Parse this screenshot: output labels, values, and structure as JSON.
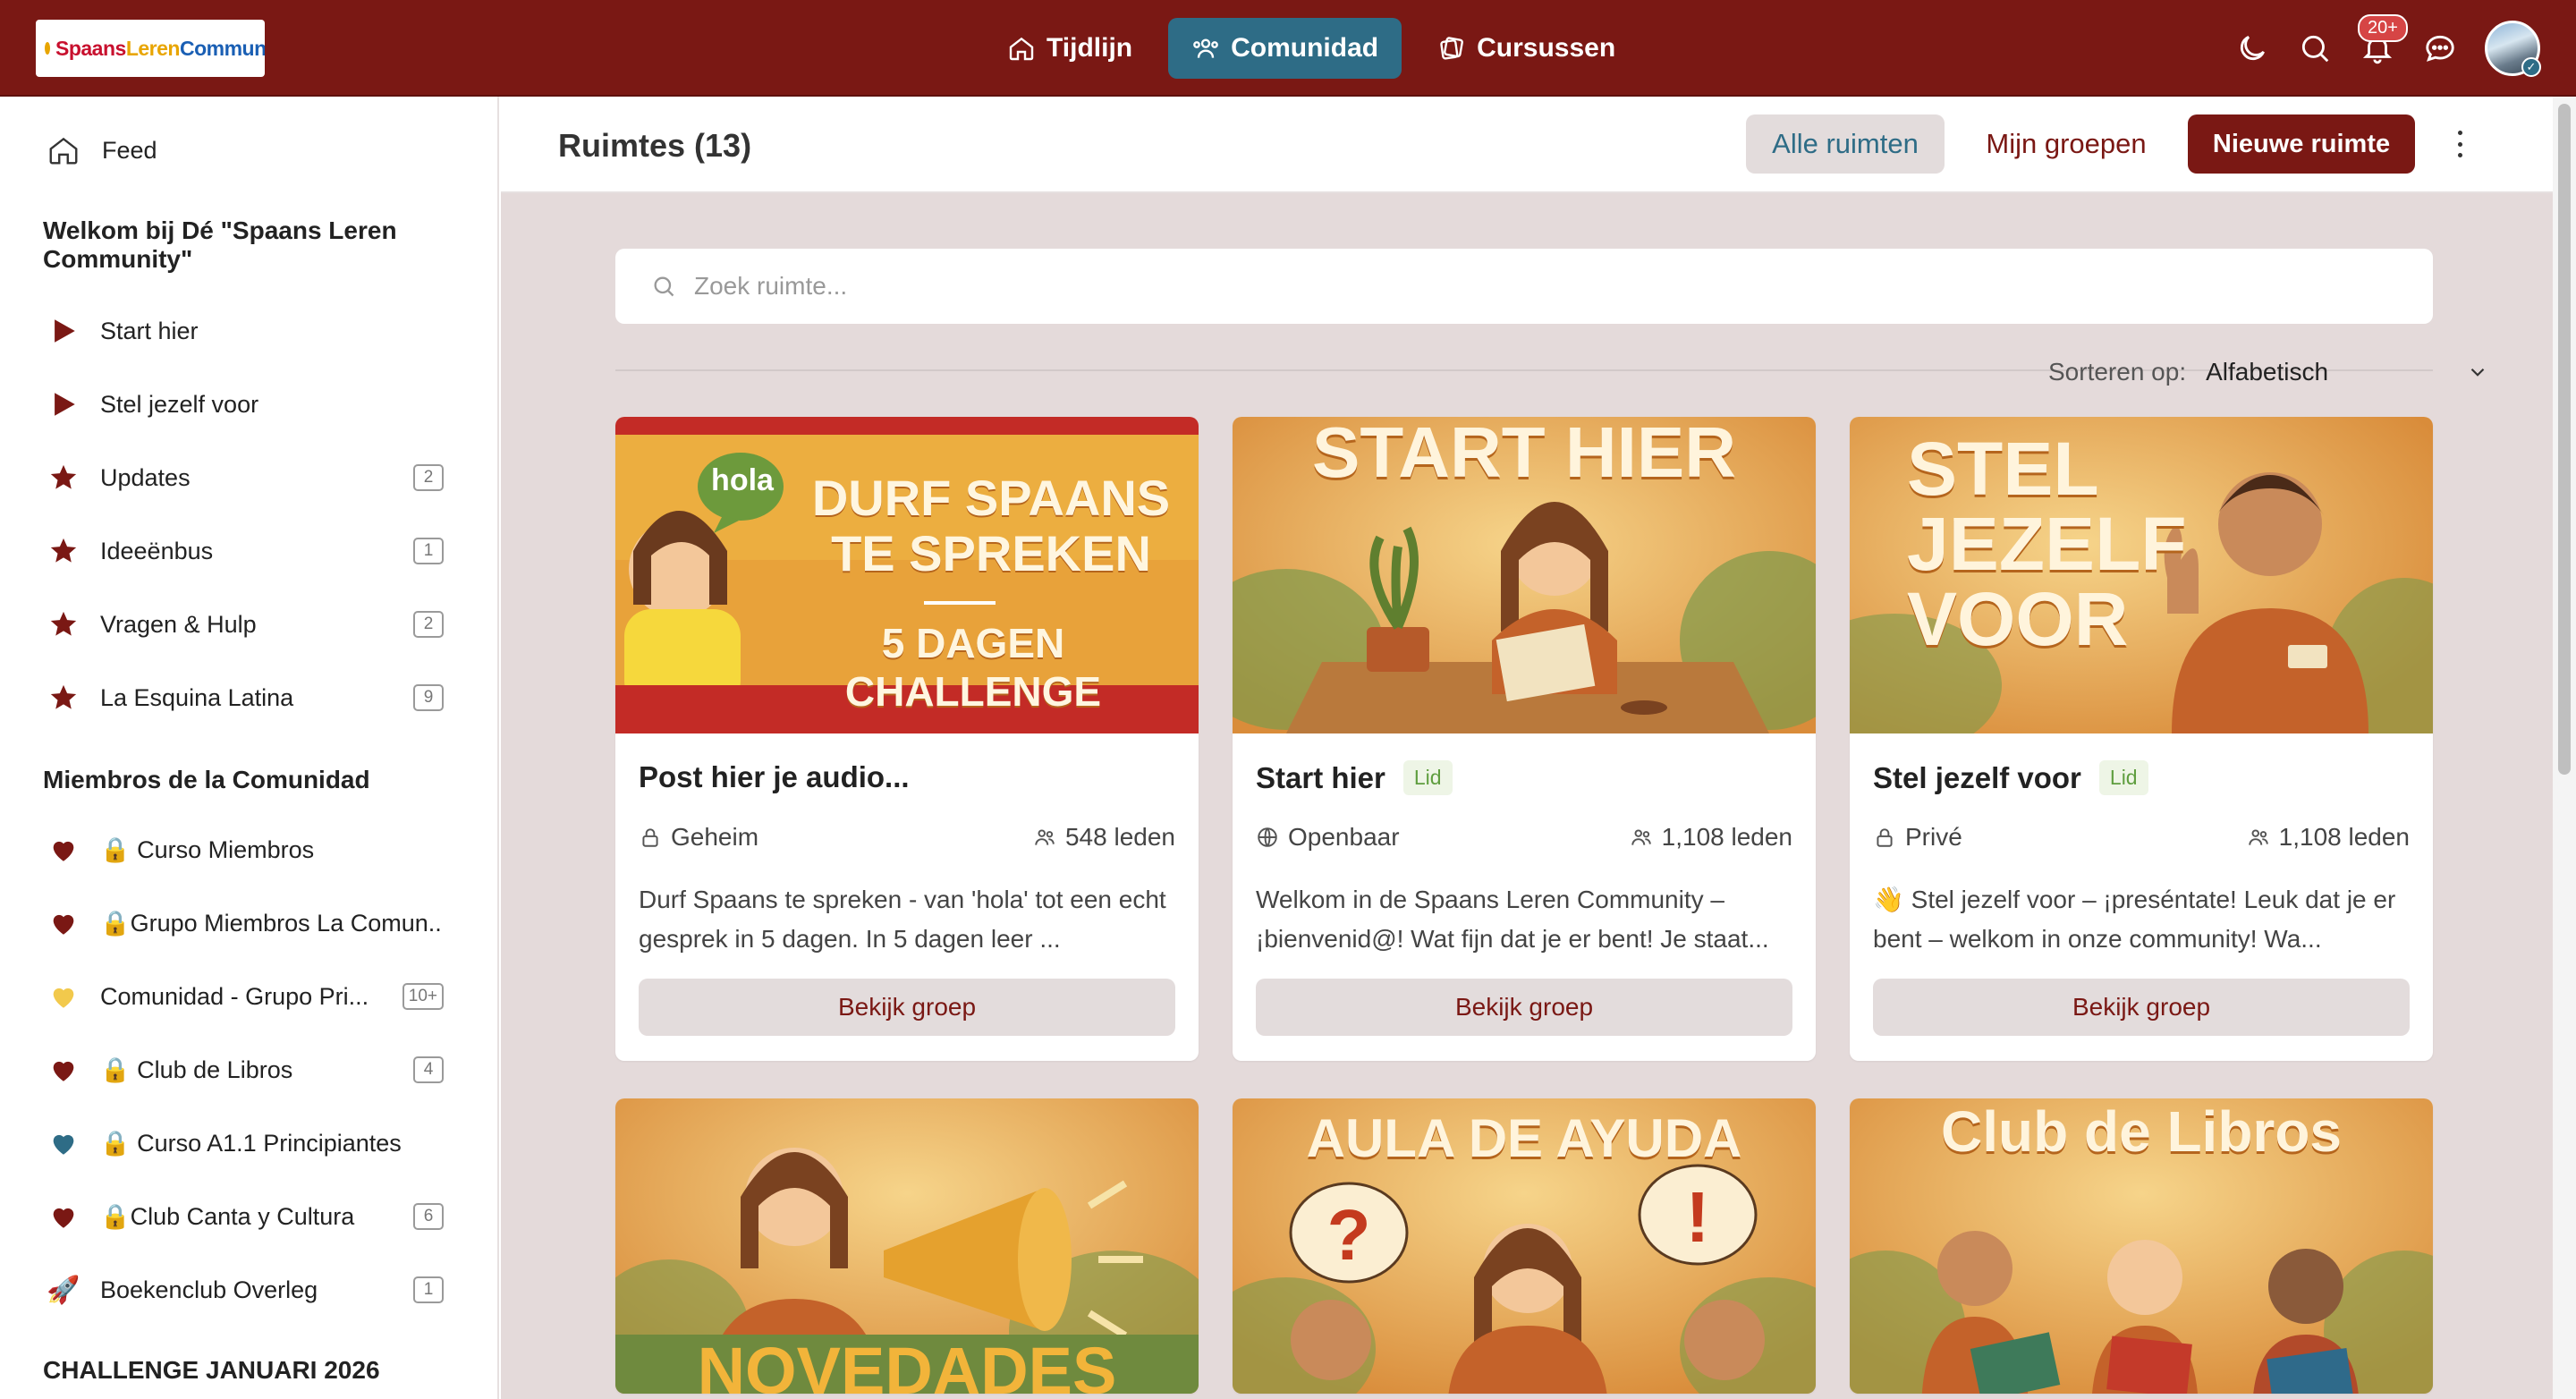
{
  "topbar": {
    "logo_text": {
      "p1": "Spaans",
      "p2": " Leren",
      "p3": " Community"
    },
    "nav": [
      {
        "label": "Tijdlijn",
        "icon": "home-icon",
        "active": false
      },
      {
        "label": "Comunidad",
        "icon": "people-icon",
        "active": true
      },
      {
        "label": "Cursussen",
        "icon": "cards-icon",
        "active": false
      }
    ],
    "notifications_badge": "20+"
  },
  "sidebar": {
    "feed_label": "Feed",
    "welcome_heading": "Welkom bij Dé \"Spaans Leren Community\"",
    "welcome_items": [
      {
        "label": "Start hier",
        "icon": "play-triangle-icon",
        "count": ""
      },
      {
        "label": "Stel jezelf voor",
        "icon": "play-triangle-icon",
        "count": ""
      },
      {
        "label": "Updates",
        "icon": "star-icon",
        "count": "2"
      },
      {
        "label": "Ideeënbus",
        "icon": "star-icon",
        "count": "1"
      },
      {
        "label": "Vragen & Hulp",
        "icon": "star-icon",
        "count": "2"
      },
      {
        "label": "La Esquina Latina",
        "icon": "star-icon",
        "count": "9"
      }
    ],
    "members_heading": "Miembros de la Comunidad",
    "members_items": [
      {
        "label": "🔒 Curso Miembros",
        "icon": "heart-icon",
        "color": "#7a1814",
        "count": ""
      },
      {
        "label": "🔒Grupo Miembros La Comun...",
        "icon": "heart-icon",
        "color": "#7a1814",
        "count": ""
      },
      {
        "label": "Comunidad - Grupo Pri...",
        "icon": "heart-icon",
        "color": "#f2c94c",
        "count": "10+"
      },
      {
        "label": "🔒 Club de Libros",
        "icon": "heart-icon",
        "color": "#7a1814",
        "count": "4"
      },
      {
        "label": "🔒 Curso A1.1 Principiantes",
        "icon": "heart-icon",
        "color": "#2e6c86",
        "count": ""
      },
      {
        "label": "🔒Club Canta y Cultura",
        "icon": "heart-icon",
        "color": "#7a1814",
        "count": "6"
      },
      {
        "label": "Boekenclub Overleg",
        "icon": "rocket-icon",
        "color": "",
        "count": "1"
      }
    ],
    "challenge_heading": "CHALLENGE JANUARI 2026"
  },
  "main": {
    "title": "Ruimtes (13)",
    "btn_all": "Alle ruimten",
    "btn_mine": "Mijn groepen",
    "btn_new": "Nieuwe ruimte",
    "search_placeholder": "Zoek ruimte...",
    "sort_label": "Sorteren op:",
    "sort_value": "Alfabetisch"
  },
  "cards": [
    {
      "title": "Post hier je audio...",
      "lid": "",
      "privacy": "Geheim",
      "privacy_icon": "lock-icon",
      "members": "548 leden",
      "desc": "Durf Spaans te spreken - van 'hola' tot een echt gesprek in 5 dagen. In 5 dagen leer ...",
      "button": "Bekijk groep",
      "img_lines": [
        "DURF SPAANS",
        "TE SPREKEN",
        "5 DAGEN CHALLENGE"
      ],
      "img_bubble": "hola"
    },
    {
      "title": "Start hier",
      "lid": "Lid",
      "privacy": "Openbaar",
      "privacy_icon": "globe-icon",
      "members": "1,108 leden",
      "desc": "Welkom in de Spaans Leren Community – ¡bienvenid@! Wat fijn dat je er bent! Je staat...",
      "button": "Bekijk groep",
      "img_lines": [
        "START HIER"
      ]
    },
    {
      "title": "Stel jezelf voor",
      "lid": "Lid",
      "privacy": "Privé",
      "privacy_icon": "lock-icon",
      "members": "1,108 leden",
      "desc": "👋 Stel jezelf voor – ¡preséntate! Leuk dat je er bent – welkom in onze community! Wa...",
      "button": "Bekijk groep",
      "img_lines": [
        "STEL",
        "JEZELF",
        "VOOR"
      ]
    },
    {
      "img_lines": [
        "NOVEDADES"
      ]
    },
    {
      "img_lines": [
        "AULA DE AYUDA"
      ]
    },
    {
      "img_lines": [
        "Club de Libros"
      ]
    }
  ],
  "colors": {
    "brand": "#7a1814",
    "accent": "#2e6c86",
    "lid_green": "#5f9e3f",
    "content_bg": "#e4dada"
  }
}
